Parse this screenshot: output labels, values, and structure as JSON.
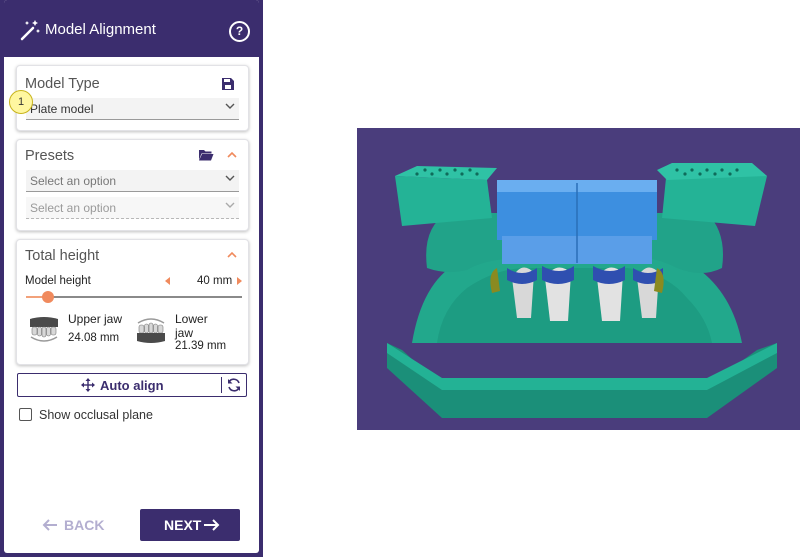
{
  "header": {
    "title": "Model Alignment",
    "help_glyph": "?"
  },
  "model_type": {
    "title": "Model Type",
    "step_badge": "1",
    "selected": "Plate model"
  },
  "presets": {
    "title": "Presets",
    "placeholder_1": "Select an option",
    "placeholder_2": "Select an option"
  },
  "total_height": {
    "title": "Total height",
    "model_height_label": "Model height",
    "model_height_value": "40 mm",
    "slider_fraction": 0.1,
    "upper_jaw": {
      "label": "Upper jaw",
      "value": "24.08 mm"
    },
    "lower_jaw": {
      "label_line1": "Lower",
      "label_line2": "jaw",
      "value": "21.39 mm"
    }
  },
  "auto_align": {
    "label": "Auto align"
  },
  "show_occlusal_plane": {
    "label": "Show occlusal plane",
    "checked": false
  },
  "footer": {
    "back_label": "BACK",
    "next_label": "NEXT"
  },
  "colors": {
    "brand": "#3b2d6e",
    "accent": "#f08a5d",
    "viewport_bg": "#4a3d7c",
    "model_base": "#1fa88e",
    "model_plate": "#3d8fe0",
    "tooth_dies": "#d8d8d8"
  },
  "icons": [
    "magic-wand-icon",
    "help-icon",
    "save-icon",
    "folder-open-icon",
    "chevron-down-icon",
    "chevron-up-icon",
    "arrow-left-icon",
    "arrow-right-icon",
    "move-icon",
    "refresh-icon",
    "upper-jaw-icon",
    "lower-jaw-icon"
  ]
}
